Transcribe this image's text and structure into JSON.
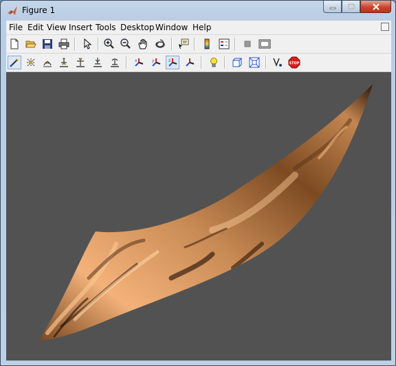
{
  "window": {
    "title": "Figure 1"
  },
  "menu": [
    "File",
    "Edit",
    "View",
    "Insert",
    "Tools",
    "Desktop",
    "Window",
    "Help"
  ],
  "toolbar1": [
    {
      "name": "new-figure-icon"
    },
    {
      "name": "open-file-icon"
    },
    {
      "name": "save-icon"
    },
    {
      "name": "print-icon"
    },
    {
      "name": "edit-plot-arrow-icon"
    },
    {
      "name": "zoom-in-icon"
    },
    {
      "name": "zoom-out-icon"
    },
    {
      "name": "pan-hand-icon"
    },
    {
      "name": "rotate-3d-icon"
    },
    {
      "name": "data-cursor-icon"
    },
    {
      "name": "insert-colorbar-icon"
    },
    {
      "name": "insert-legend-icon"
    },
    {
      "name": "hide-plot-tools-icon"
    },
    {
      "name": "show-plot-tools-icon"
    }
  ],
  "toolbar2": [
    {
      "name": "orbit-camera-icon"
    },
    {
      "name": "orbit-scene-light-icon"
    },
    {
      "name": "pan-tilt-camera-icon"
    },
    {
      "name": "move-camera-horizontal-icon"
    },
    {
      "name": "move-camera-forward-back-icon"
    },
    {
      "name": "zoom-camera-icon"
    },
    {
      "name": "roll-camera-icon"
    },
    {
      "name": "principal-axis-x-icon"
    },
    {
      "name": "principal-axis-y-icon"
    },
    {
      "name": "principal-axis-z-icon"
    },
    {
      "name": "principal-axis-none-icon"
    },
    {
      "name": "toggle-scene-light-icon"
    },
    {
      "name": "orthographic-projection-icon"
    },
    {
      "name": "perspective-projection-icon"
    },
    {
      "name": "reset-camera-icon"
    },
    {
      "name": "stop-camera-icon"
    }
  ],
  "toolbar2_active": "principal-axis-z-icon",
  "colors": {
    "axes_background": "#525252",
    "surface_light": "#f3b77f",
    "surface_dark": "#3a200e"
  }
}
